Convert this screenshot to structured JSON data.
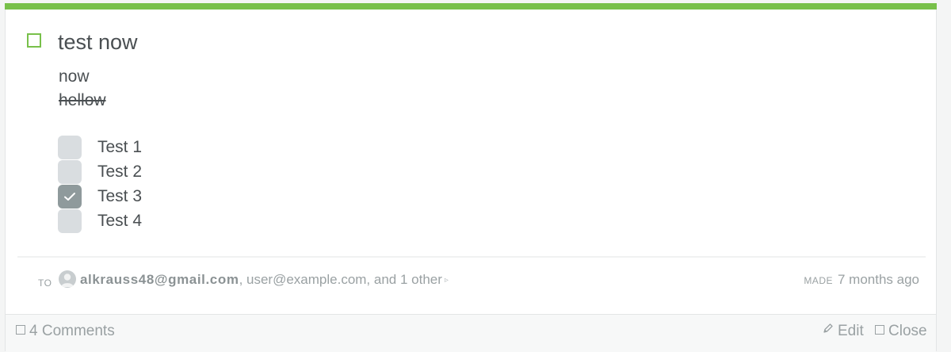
{
  "task": {
    "title": "test now",
    "accent_color": "#78c04a",
    "body_lines": [
      "now",
      "hellow"
    ],
    "checklist": [
      {
        "label": "Test 1",
        "checked": false
      },
      {
        "label": "Test 2",
        "checked": false
      },
      {
        "label": "Test 3",
        "checked": true
      },
      {
        "label": "Test 4",
        "checked": false
      }
    ]
  },
  "meta": {
    "to_label": "TO",
    "primary_recipient": "alkrauss48@gmail.com",
    "other_recipients": ", user@example.com, and ",
    "more_link": "1 other",
    "more_arrow": "▹",
    "made_label": "MADE",
    "made_time": "7 months ago"
  },
  "footer": {
    "comments_label": "4 Comments",
    "edit_label": "Edit",
    "close_label": "Close"
  },
  "icons": {
    "task_checkbox": "square-checkbox-icon",
    "comments": "comment-icon",
    "edit": "pencil-icon",
    "close": "close-square-icon",
    "avatar": "user-avatar-icon"
  }
}
